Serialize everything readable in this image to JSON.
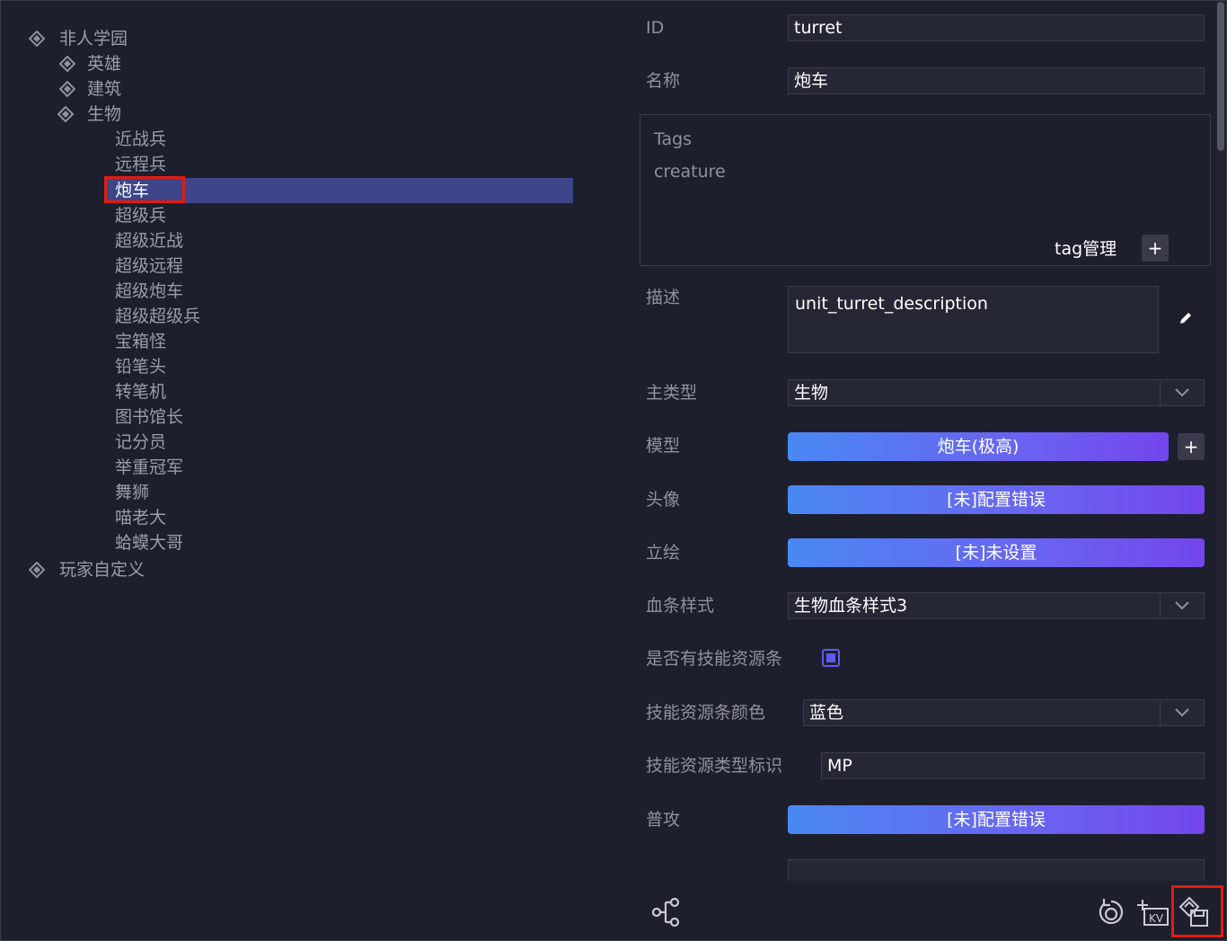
{
  "tree": {
    "root": "非人学园",
    "groups": [
      "英雄",
      "建筑",
      "生物"
    ],
    "creatures": [
      "近战兵",
      "远程兵",
      "炮车",
      "超级兵",
      "超级近战",
      "超级远程",
      "超级炮车",
      "超级超级兵",
      "宝箱怪",
      "铅笔头",
      "转笔机",
      "图书馆长",
      "记分员",
      "举重冠军",
      "舞狮",
      "喵老大",
      "蛤蟆大哥"
    ],
    "selected": "炮车",
    "custom": "玩家自定义"
  },
  "panel": {
    "id_label": "ID",
    "id_value": "turret",
    "name_label": "名称",
    "name_value": "炮车",
    "tags_title": "Tags",
    "tags_value": "creature",
    "tag_manage": "tag管理",
    "add": "+",
    "desc_label": "描述",
    "desc_value": "unit_turret_description",
    "main_type_label": "主类型",
    "main_type_value": "生物",
    "model_label": "模型",
    "model_value": "炮车(极高)",
    "avatar_label": "头像",
    "avatar_value": "[未]配置错误",
    "portrait_label": "立绘",
    "portrait_value": "[未]未设置",
    "hpbar_label": "血条样式",
    "hpbar_value": "生物血条样式3",
    "has_resource_label": "是否有技能资源条",
    "resource_color_label": "技能资源条颜色",
    "resource_color_value": "蓝色",
    "resource_type_label": "技能资源类型标识",
    "resource_type_value": "MP",
    "attack_label": "普攻",
    "attack_value": "[未]配置错误"
  },
  "toolbar": {
    "kv_text": "KV"
  },
  "colors": {
    "background": "#1e1f2c",
    "selection": "#3c4688",
    "highlight": "#e21b12",
    "gradient_start": "#4a88f3",
    "gradient_end": "#7346ec"
  }
}
